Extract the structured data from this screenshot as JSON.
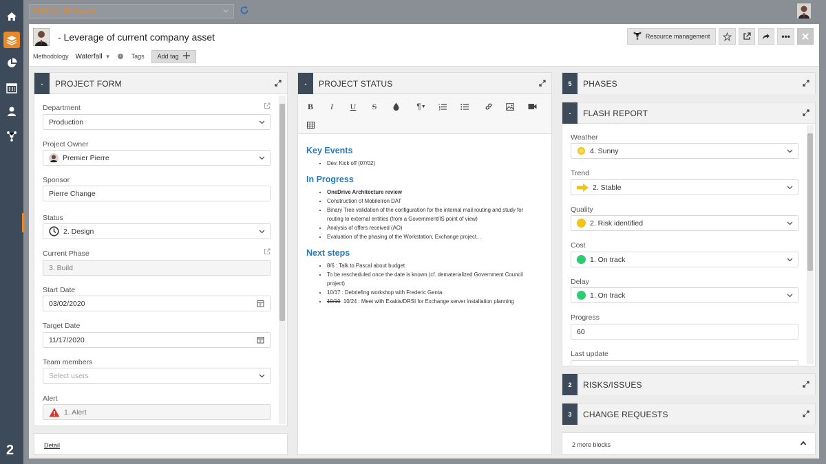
{
  "sidebar": {
    "icons": [
      "home-icon",
      "layers-icon",
      "pie-chart-icon",
      "calendar-icon",
      "users-icon",
      "hierarchy-icon"
    ],
    "logo": "2",
    "accent": "#e8882a"
  },
  "topbar": {
    "project_selector": "PMO 01. All Projects"
  },
  "header": {
    "title": "- Leverage of current company asset",
    "methodology_label": "Methodology",
    "methodology_value": "Waterfall",
    "tags_label": "Tags",
    "add_tag_label": "Add tag",
    "resource_management_label": "Resource management"
  },
  "project_form": {
    "badge": "-",
    "title": "PROJECT FORM",
    "fields": {
      "department": {
        "label": "Department",
        "value": "Production"
      },
      "owner": {
        "label": "Project Owner",
        "value": "Premier Pierre"
      },
      "sponsor": {
        "label": "Sponsor",
        "value": "Pierre Change"
      },
      "status": {
        "label": "Status",
        "value": "2. Design"
      },
      "phase": {
        "label": "Current Phase",
        "value": "3. Build"
      },
      "start": {
        "label": "Start Date",
        "value": "03/02/2020"
      },
      "target": {
        "label": "Target Date",
        "value": "11/17/2020"
      },
      "team": {
        "label": "Team members",
        "placeholder": "Select users"
      },
      "alert": {
        "label": "Alert",
        "value": "1. Alert"
      }
    },
    "detail_link": "Detail"
  },
  "project_status": {
    "badge": "-",
    "title": "PROJECT STATUS",
    "sections": [
      {
        "heading": "Key Events",
        "items": [
          "Dev. Kick off (07/02)"
        ]
      },
      {
        "heading": "In Progress",
        "items": [
          "OneDrive Architecture review",
          "Construction of MobileIron DAT",
          "Binary Tree validation of the configuration for the internal mail routing and study for routing to external entities (from a Government/IS point of view)",
          "Analysis of offers received (AO)",
          "Evaluation of the phasing of the Workstation, Exchange project..."
        ]
      },
      {
        "heading": "Next steps",
        "items": [
          "8/6 : Talk to Pascal about budget",
          "To be rescheduled once the date is known (cf. dematerialized Government Council project)",
          "10/17 : Debriefing workshop with Frederic Genta.",
          "10/24 : Meet with Exakis/DRSI for Exchange server installation planning"
        ],
        "struck_prefix": "10/10"
      }
    ]
  },
  "phases": {
    "badge": "5",
    "title": "PHASES"
  },
  "flash_report": {
    "badge": "-",
    "title": "FLASH REPORT",
    "weather": {
      "label": "Weather",
      "value": "4. Sunny",
      "color": "#f0c419"
    },
    "trend": {
      "label": "Trend",
      "value": "2. Stable",
      "color": "#f0c419"
    },
    "quality": {
      "label": "Quality",
      "value": "2. Risk identified",
      "color": "#f0c419"
    },
    "cost": {
      "label": "Cost",
      "value": "1. On track",
      "color": "#2ecc71"
    },
    "delay": {
      "label": "Delay",
      "value": "1. On track",
      "color": "#2ecc71"
    },
    "progress": {
      "label": "Progress",
      "value": "60"
    },
    "last_update": {
      "label": "Last update"
    }
  },
  "risks": {
    "badge": "2",
    "title": "RISKS/ISSUES"
  },
  "change_requests": {
    "badge": "3",
    "title": "CHANGE REQUESTS"
  },
  "more_blocks": "2 more blocks"
}
